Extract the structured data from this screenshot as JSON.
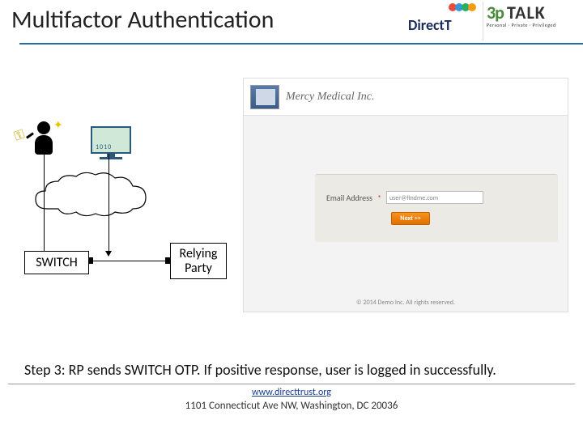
{
  "header": {
    "title": "Multifactor Authentication",
    "logo_direct": "DirectT",
    "logo_talk_sp": "3p",
    "logo_talk_word": "TALK",
    "logo_talk_tag": "Personal · Private · Privileged"
  },
  "diagram": {
    "switch_label": "SWITCH",
    "rp_label": "Relying Party"
  },
  "browser": {
    "brand": "Mercy Medical Inc.",
    "email_label": "Email Address",
    "required_mark": "*",
    "email_value": "user@findme.com",
    "next_label": "Next >>",
    "copyright": "© 2014 Demo Inc. All rights reserved."
  },
  "caption": "Step 3: RP sends SWITCH OTP. If positive response, user is logged in successfully.",
  "footer": {
    "link": "www.directtrust.org",
    "address": "1101 Connecticut Ave NW, Washington, DC 20036"
  }
}
